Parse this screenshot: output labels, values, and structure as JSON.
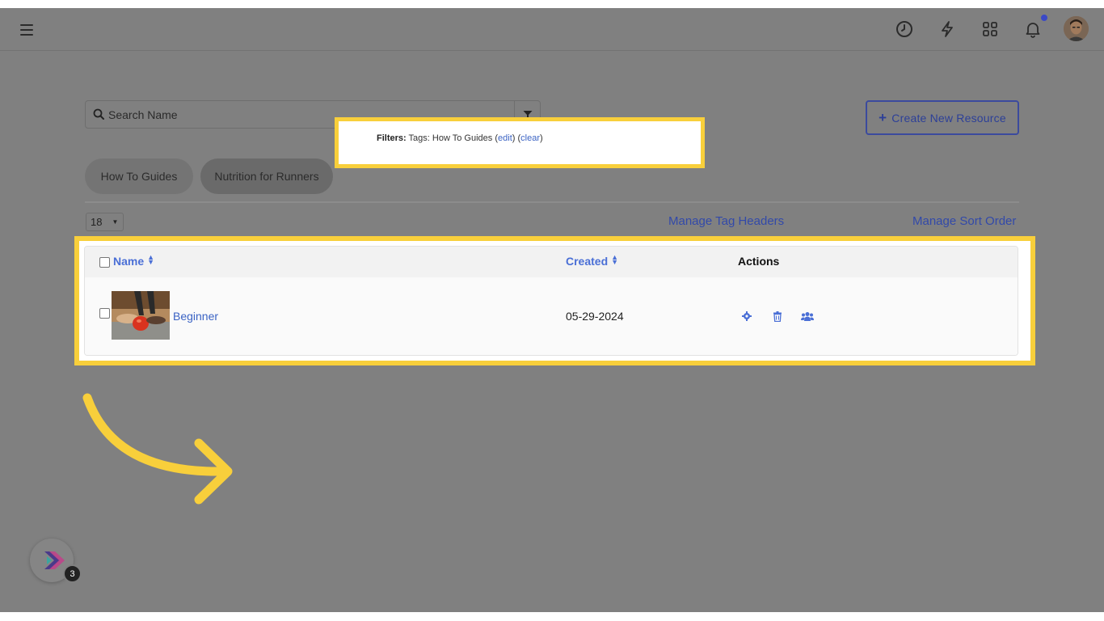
{
  "header": {
    "menu_icon": "hamburger-icon",
    "icons": [
      "clock-icon",
      "bolt-icon",
      "grid-icon",
      "bell-icon"
    ],
    "notification_dot_color": "#3b49c6",
    "avatar": "user-avatar"
  },
  "search": {
    "placeholder": "Search Name",
    "value": ""
  },
  "filters": {
    "label": "Filters:",
    "text": "Tags: How To Guides",
    "edit": "edit",
    "clear": "clear"
  },
  "create_button": {
    "plus": "+",
    "label": "Create New Resource"
  },
  "tags": [
    {
      "label": "How To Guides"
    },
    {
      "label": "Nutrition for Runners"
    }
  ],
  "pager": {
    "value": "18"
  },
  "links": {
    "manage_tag_headers": "Manage Tag Headers",
    "manage_sort_order": "Manage Sort Order"
  },
  "table": {
    "columns": {
      "name": "Name",
      "created": "Created",
      "actions": "Actions"
    },
    "rows": [
      {
        "name": "Beginner",
        "created": "05-29-2024",
        "actions": [
          "gear-icon",
          "trash-icon",
          "users-icon"
        ]
      }
    ]
  },
  "launcher": {
    "badge": "3"
  },
  "colors": {
    "highlight": "#f8cf3b",
    "link": "#3b63c4",
    "overlay": "#808080"
  }
}
